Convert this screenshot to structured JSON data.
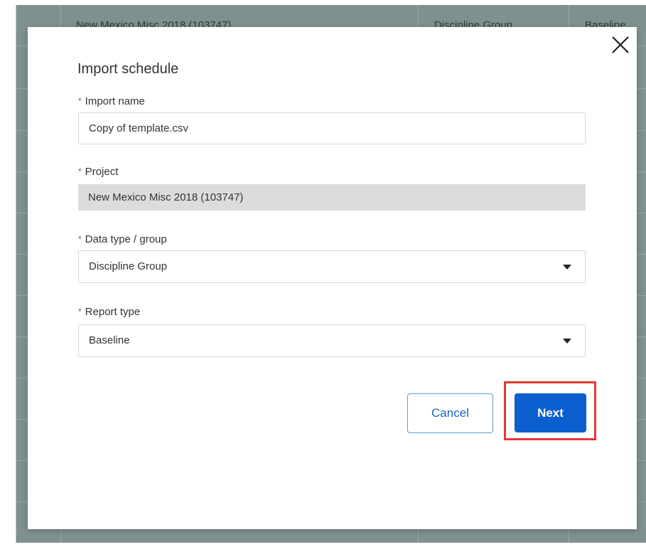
{
  "background": {
    "project_column_text": "New Mexico Misc 2018 (103747)",
    "group_column_text": "Discipline Group",
    "report_column_text": "Baseline"
  },
  "dialog": {
    "title": "Import schedule",
    "required_marker": "*",
    "fields": {
      "import_name": {
        "label": "Import name",
        "value": "Copy of template.csv"
      },
      "project": {
        "label": "Project",
        "value": "New Mexico Misc 2018 (103747)"
      },
      "data_type": {
        "label": "Data type / group",
        "value": "Discipline Group"
      },
      "report_type": {
        "label": "Report type",
        "value": "Baseline"
      }
    },
    "buttons": {
      "cancel": "Cancel",
      "next": "Next"
    }
  },
  "colors": {
    "primary": "#0b5fcf",
    "highlight": "#e53935",
    "overlay": "#7f918f"
  },
  "icons": {
    "close": "close-icon",
    "dropdown": "caret-down-icon"
  }
}
